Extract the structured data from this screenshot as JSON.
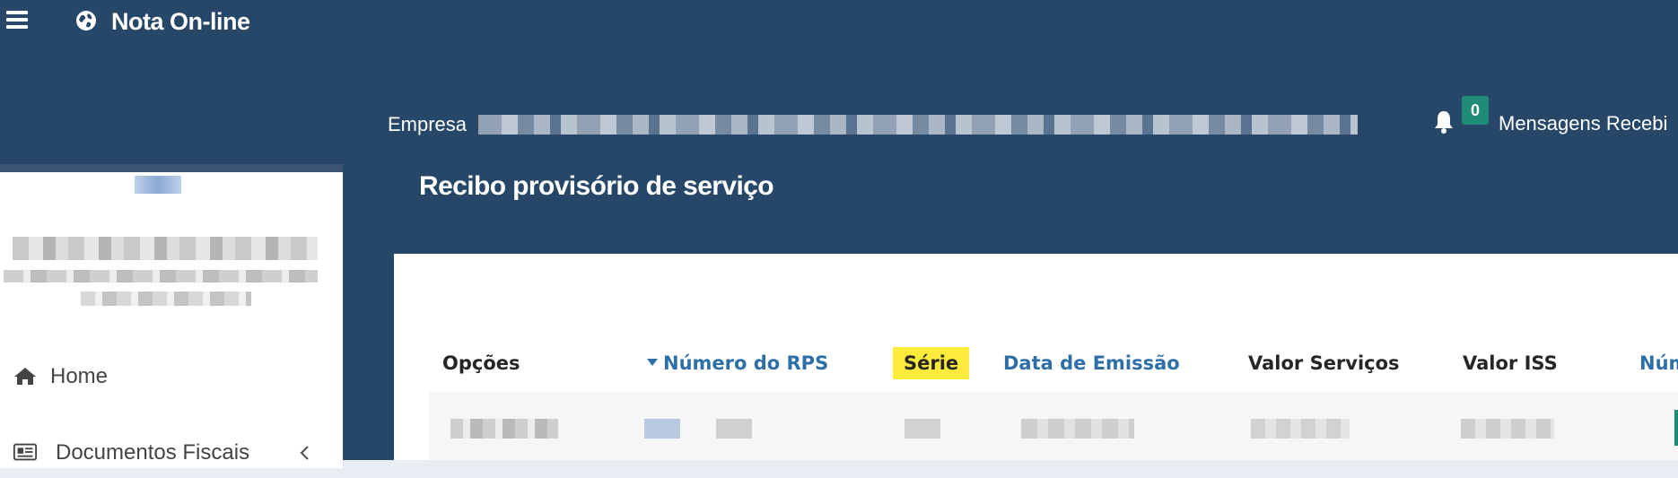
{
  "app": {
    "title": "Nota On-line"
  },
  "header": {
    "company_label": "Empresa",
    "notifications_count": "0",
    "messages_label": "Mensagens Recebi"
  },
  "sidebar": {
    "items": [
      {
        "label": "Home",
        "icon": "home-icon"
      },
      {
        "label": "Documentos Fiscais",
        "icon": "newspaper-icon",
        "expand_icon": "chevron-left-icon"
      }
    ]
  },
  "page": {
    "title": "Recibo provisório de serviço"
  },
  "table": {
    "columns": [
      {
        "label": "Opções"
      },
      {
        "label": "Número do RPS",
        "sort": "descending"
      },
      {
        "label": "Série",
        "highlight": "#ffeb3b"
      },
      {
        "label": "Data de Emissão"
      },
      {
        "label": "Valor Serviços"
      },
      {
        "label": "Valor ISS"
      },
      {
        "label": "Núm"
      }
    ]
  },
  "colors": {
    "navbar": "#274769",
    "badge": "#1e8c76",
    "link": "#2e6fa8",
    "highlight": "#ffeb3b"
  }
}
